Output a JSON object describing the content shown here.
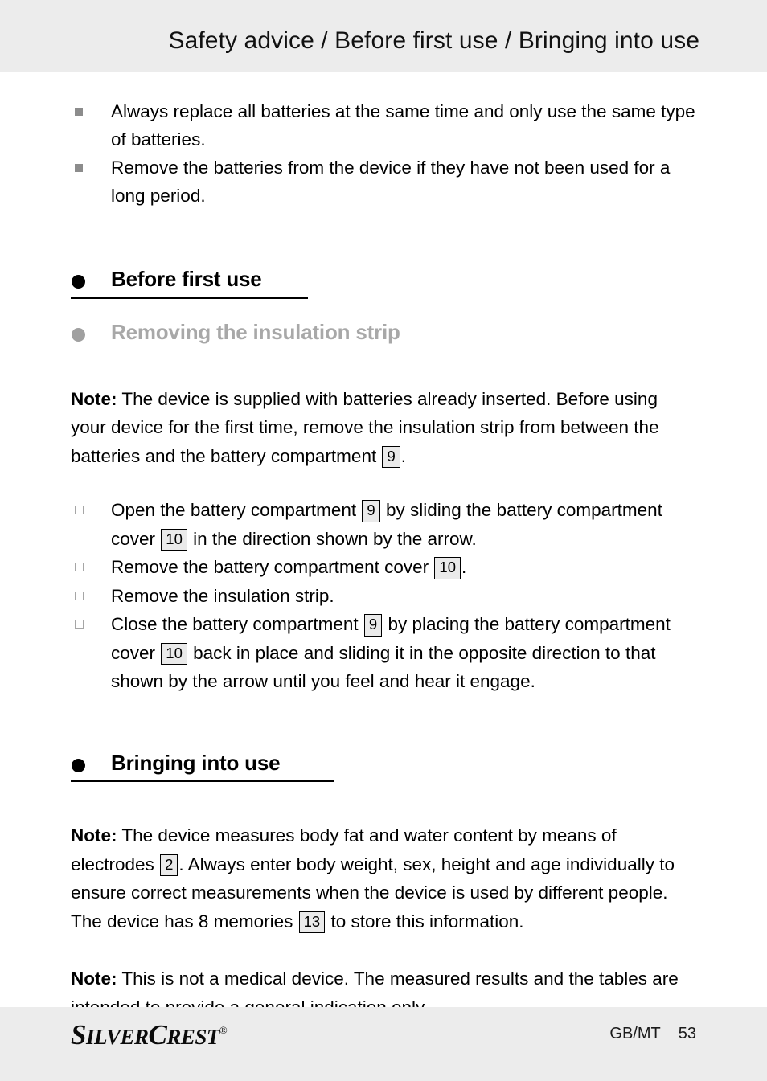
{
  "header": {
    "title": "Safety advice / Before first use / Bringing into use"
  },
  "warnings": [
    "Always replace all batteries at the same time and only use the same type of batteries.",
    "Remove the batteries from the device if they have not been used for a long period."
  ],
  "sections": {
    "before_first_use": {
      "heading": "Before first use",
      "subheading": "Removing the insulation strip",
      "note_label": "Note:",
      "note_part1": " The device is supplied with batteries already inserted. Before using your device for the first time, remove the insulation strip from between the batteries and the battery compartment ",
      "note_ref1": "9",
      "note_part2": ".",
      "steps": [
        {
          "text_1": "Open the battery compartment ",
          "ref_1": "9",
          "text_2": " by sliding the battery compartment cover ",
          "ref_2": "10",
          "text_3": " in the direction shown by the arrow."
        },
        {
          "text_1": "Remove the battery compartment cover ",
          "ref_1": "10",
          "text_2": ".",
          "ref_2": "",
          "text_3": ""
        },
        {
          "text_1": "Remove the insulation strip.",
          "ref_1": "",
          "text_2": "",
          "ref_2": "",
          "text_3": ""
        },
        {
          "text_1": "Close the battery compartment ",
          "ref_1": "9",
          "text_2": " by placing the battery compartment cover ",
          "ref_2": "10",
          "text_3": " back in place and sliding it in the opposite direction to that shown by the arrow until you feel and hear it engage."
        }
      ]
    },
    "bringing_into_use": {
      "heading": "Bringing into use",
      "note1_label": "Note:",
      "note1_part1": " The device measures body fat and water content by means of electrodes ",
      "note1_ref1": "2",
      "note1_part2": ". Always enter body weight, sex, height and age individually to ensure correct measurements when the device is used by different people. The device has 8 memories ",
      "note1_ref2": "13",
      "note1_part3": " to store this information.",
      "note2_label": "Note:",
      "note2_text": " This is not a medical device. The measured results and the tables are intended to provide a general indication only."
    }
  },
  "footer": {
    "brand_part1": "S",
    "brand_part2": "ILVER",
    "brand_part3": "C",
    "brand_part4": "REST",
    "brand_reg": "®",
    "locale": "GB/MT",
    "page_number": "53"
  },
  "colors": {
    "band": "#ececec",
    "page": "#ffffff",
    "muted_heading": "#a8a8a8",
    "bullet_gray": "#8c8c8c",
    "refbox_fill": "#eaeaea"
  }
}
